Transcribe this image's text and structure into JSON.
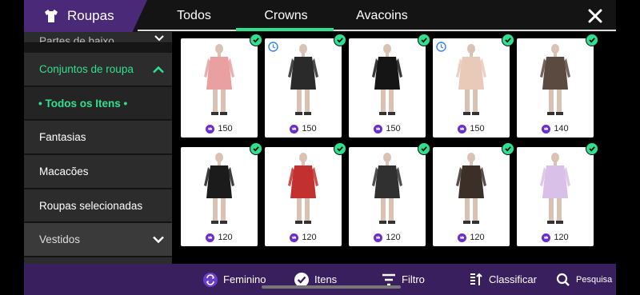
{
  "header": {
    "category_label": "Roupas",
    "tabs": [
      {
        "label": "Todos",
        "active": false
      },
      {
        "label": "Crowns",
        "active": true
      },
      {
        "label": "Avacoins",
        "active": false
      }
    ],
    "close_icon": "close-icon"
  },
  "sidebar": {
    "items": [
      {
        "label": "Partes de baixo",
        "state": "collapsed",
        "partial": true
      },
      {
        "label": "Conjuntos de roupa",
        "state": "expanded",
        "highlight": true
      },
      {
        "label": "• Todos os Itens •",
        "selected": true
      },
      {
        "label": "Fantasias"
      },
      {
        "label": "Macacões"
      },
      {
        "label": "Roupas selecionadas"
      },
      {
        "label": "Vestidos",
        "state": "collapsed"
      }
    ]
  },
  "grid": {
    "items": [
      {
        "price": "150",
        "owned": true,
        "timed": false,
        "color": "#e8a0a0"
      },
      {
        "price": "150",
        "owned": true,
        "timed": true,
        "color": "#2a2a2a"
      },
      {
        "price": "150",
        "owned": true,
        "timed": false,
        "color": "#151515"
      },
      {
        "price": "150",
        "owned": true,
        "timed": true,
        "color": "#e9c9b8"
      },
      {
        "price": "140",
        "owned": true,
        "timed": false,
        "color": "#5a4a40"
      },
      {
        "price": "120",
        "owned": true,
        "timed": false,
        "color": "#1b1b1b"
      },
      {
        "price": "120",
        "owned": true,
        "timed": false,
        "color": "#c23030"
      },
      {
        "price": "120",
        "owned": true,
        "timed": false,
        "color": "#303030"
      },
      {
        "price": "120",
        "owned": true,
        "timed": false,
        "color": "#3b2f28"
      },
      {
        "price": "120",
        "owned": true,
        "timed": false,
        "color": "#d8c0e8"
      }
    ]
  },
  "bottom_bar": {
    "feminino": "Feminino",
    "itens": "Itens",
    "filtro": "Filtro",
    "classificar": "Classificar",
    "pesquisa": "Pesquisa"
  },
  "colors": {
    "accent_green": "#2fe08f",
    "header_purple": "#4a2a78",
    "bottom_purple": "#3a1f5e",
    "crown_coin": "#6a2fc9"
  }
}
